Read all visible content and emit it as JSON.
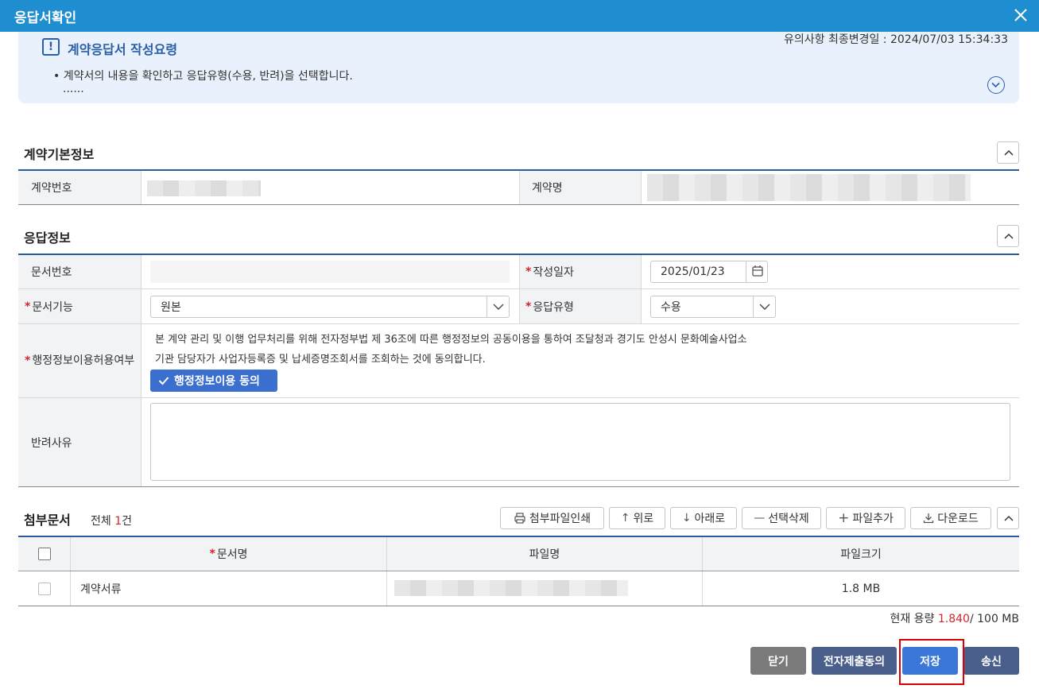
{
  "window": {
    "title": "응답서확인"
  },
  "notice": {
    "heading": "계약응답서 작성요령",
    "updated_label": "유의사항 최종변경일 : 2024/07/03 15:34:33",
    "bullet": "• 계약서의 내용을 확인하고 응답유형(수용, 반려)을 선택합니다.",
    "ellipsis": "......"
  },
  "basic_info": {
    "title": "계약기본정보",
    "contract_no_label": "계약번호",
    "contract_name_label": "계약명"
  },
  "response_info": {
    "title": "응답정보",
    "doc_no_label": "문서번호",
    "written_date_label": "작성일자",
    "written_date_value": "2025/01/23",
    "doc_function_label": "문서기능",
    "doc_function_value": "원본",
    "response_type_label": "응답유형",
    "response_type_value": "수용",
    "admin_info_label": "행정정보이용허용여부",
    "admin_info_text_1": "본 계약 관리 및 이행 업무처리를 위해 전자정부법 제 36조에 따른 행정정보의 공동이용을 통하여 조달청과  경기도 안성시 문화예술사업소",
    "admin_info_text_2": "기관 담당자가 사업자등록증 및 납세증명조회서를 조회하는 것에 동의합니다.",
    "admin_agree_button": "행정정보이용 동의",
    "reject_reason_label": "반려사유"
  },
  "attachments": {
    "title": "첨부문서",
    "total_prefix": "전체",
    "total_count": "1",
    "total_suffix": "건",
    "buttons": {
      "print": "첨부파일인쇄",
      "up": "위로",
      "down": "아래로",
      "delete": "선택삭제",
      "add": "파일추가",
      "download": "다운로드"
    },
    "columns": [
      "문서명",
      "파일명",
      "파일크기"
    ],
    "rows": [
      {
        "doc_name": "계약서류",
        "file_size": "1.8 MB"
      }
    ],
    "capacity_prefix": "현재 용량",
    "capacity_used": "1.840",
    "capacity_total": "/ 100 MB"
  },
  "footer": {
    "close": "닫기",
    "e_submit_agree": "전자제출동의",
    "save": "저장",
    "send": "송신"
  },
  "colors": {
    "titlebar": "#1f8ed0",
    "accent": "#2c5aa0",
    "required": "#d0262c",
    "btn_gray": "#7b7b7b",
    "btn_navy": "#4a5e8c",
    "btn_blue": "#3a77d8"
  }
}
